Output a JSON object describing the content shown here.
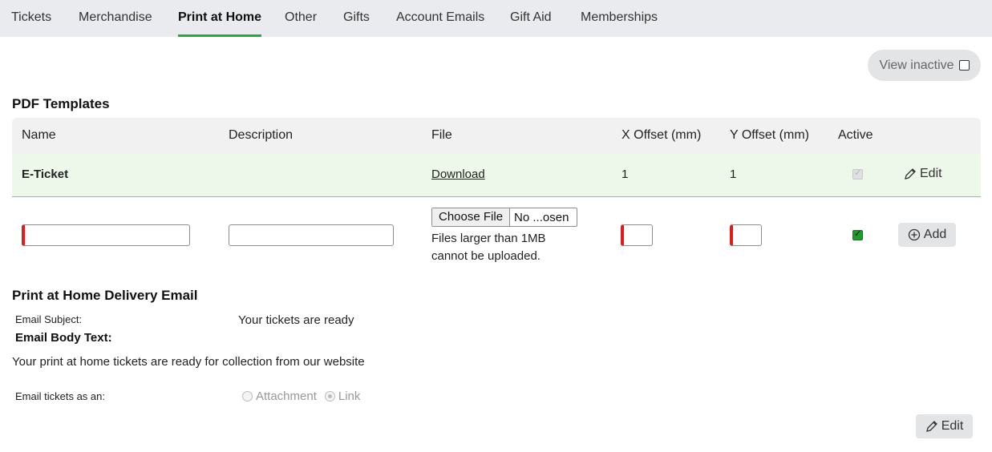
{
  "tabs": [
    {
      "label": "Tickets",
      "active": false
    },
    {
      "label": "Merchandise",
      "active": false
    },
    {
      "label": "Print at Home",
      "active": true
    },
    {
      "label": "Other",
      "active": false
    },
    {
      "label": "Gifts",
      "active": false
    },
    {
      "label": "Account Emails",
      "active": false
    },
    {
      "label": "Gift Aid",
      "active": false
    },
    {
      "label": "Memberships",
      "active": false
    }
  ],
  "view_inactive": {
    "label": "View inactive",
    "checked": false
  },
  "pdf_templates": {
    "title": "PDF Templates",
    "columns": [
      "Name",
      "Description",
      "File",
      "X Offset (mm)",
      "Y Offset (mm)",
      "Active"
    ],
    "rows": [
      {
        "name": "E-Ticket",
        "description": "",
        "file_link": "Download",
        "x_offset": "1",
        "y_offset": "1",
        "active": true,
        "action": "Edit"
      }
    ],
    "new_row": {
      "file_button": "Choose File",
      "file_status": "No ...osen",
      "file_note": "Files larger than 1MB cannot be uploaded.",
      "active": true,
      "add_label": "Add"
    }
  },
  "delivery_email": {
    "title": "Print at Home Delivery Email",
    "subject_label": "Email Subject:",
    "subject_value": "Your tickets are ready",
    "body_label": "Email Body Text:",
    "body_value": "Your print at home tickets are ready for collection from our website",
    "format_label": "Email tickets as an:",
    "options": [
      {
        "label": "Attachment",
        "selected": false
      },
      {
        "label": "Link",
        "selected": true
      }
    ],
    "edit_label": "Edit"
  },
  "colors": {
    "accent": "#1fae2f",
    "required": "#e01b1b",
    "row_highlight": "#edf7ea",
    "tabbar_bg": "#e9ebee"
  }
}
